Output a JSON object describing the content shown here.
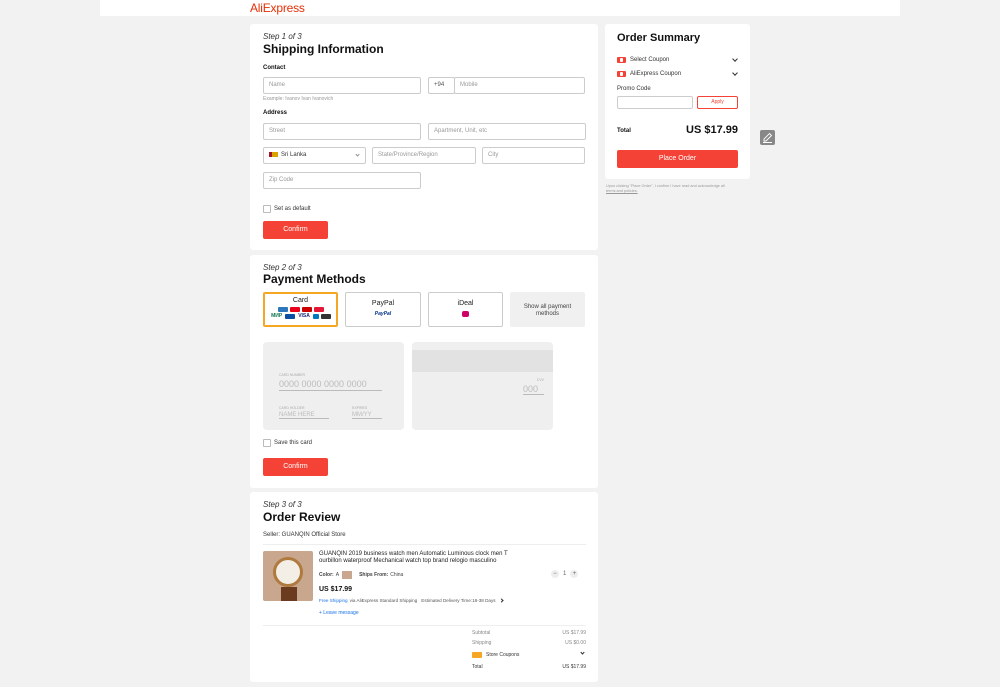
{
  "header": {
    "logo": "AliExpress"
  },
  "step1": {
    "step_label": "Step 1 of 3",
    "title": "Shipping Information",
    "contact_heading": "Contact",
    "name_placeholder": "Name",
    "phone_code": "+94",
    "mobile_placeholder": "Mobile",
    "name_example": "Example: Ivanov Ivan Ivanovich",
    "address_heading": "Address",
    "street_placeholder": "Street",
    "apartment_placeholder": "Apartment, Unit, etc",
    "country": "Sri Lanka",
    "state_placeholder": "State/Province/Region",
    "city_placeholder": "City",
    "zip_placeholder": "Zip Code",
    "set_default_label": "Set as default",
    "confirm_label": "Confirm"
  },
  "step2": {
    "step_label": "Step 2 of 3",
    "title": "Payment Methods",
    "methods": [
      {
        "label": "Card"
      },
      {
        "label": "PayPal",
        "logo_text": "PayPal"
      },
      {
        "label": "iDeal"
      },
      {
        "label": "Show all payment methods"
      }
    ],
    "card_logos": [
      "VISA",
      "МИР"
    ],
    "card_front": {
      "number_label": "CARD NUMBER",
      "number_placeholder": "0000 0000 0000 0000",
      "holder_label": "CARD HOLDER",
      "holder_placeholder": "NAME HERE",
      "expiry_label": "EXPIRES",
      "expiry_placeholder": "MM/YY"
    },
    "card_back": {
      "cvv_label": "CVV",
      "cvv_placeholder": "000"
    },
    "save_card_label": "Save this card",
    "confirm_label": "Confirm"
  },
  "step3": {
    "step_label": "Step 3 of 3",
    "title": "Order Review",
    "seller": "Seller: GUANQIN Official Store",
    "product": {
      "title": "GUANQIN 2019 business watch men Automatic Luminous clock men T ourbillon waterproof Mechanical watch top brand relogio masculino",
      "color_label": "Color:",
      "color_value": "A",
      "ships_from_label": "Ships From:",
      "ships_from_value": "China",
      "quantity": "1",
      "price": "US $17.99",
      "free_shipping": "Free Shipping",
      "shipping_detail": "via AliExpress Standard Shipping",
      "delivery": "Estimated Delivery Time:18-38 Days",
      "leave_message": "+ Leave message"
    },
    "totals": {
      "subtotal_label": "Subtotal",
      "subtotal_value": "US $17.99",
      "shipping_label": "Shipping",
      "shipping_value": "US $0.00",
      "store_coupons_label": "Store Coupons",
      "total_label": "Total",
      "total_value": "US $17.99"
    }
  },
  "summary": {
    "title": "Order Summary",
    "select_coupon": "Select Coupon",
    "aliexpress_coupon": "AliExpress Coupon",
    "promo_label": "Promo Code",
    "apply_label": "Apply",
    "total_label": "Total",
    "total_value": "US $17.99",
    "place_order_label": "Place Order",
    "disclaimer_1": "Upon clicking \"Place Order\", I confirm I have read and acknowledge all",
    "disclaimer_2": "terms and policies."
  },
  "colors": {
    "brand_red": "#f44336",
    "logo_red": "#e62e04",
    "selected_gold": "#f5a623",
    "link_blue": "#1a73e8"
  }
}
